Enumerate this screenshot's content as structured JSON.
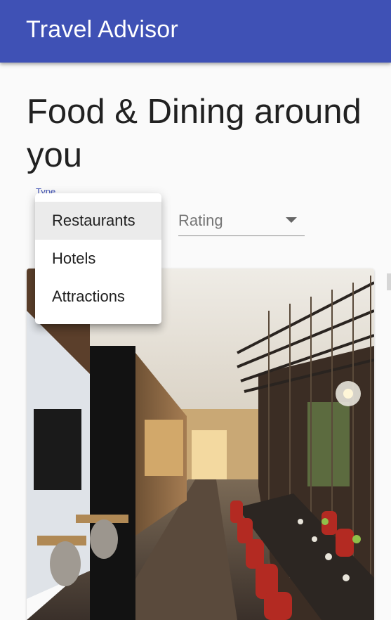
{
  "app": {
    "title": "Travel Advisor"
  },
  "page": {
    "title": "Food & Dining around you"
  },
  "type_select": {
    "label": "Type",
    "selected": "Restaurants",
    "options": [
      "Restaurants",
      "Hotels",
      "Attractions"
    ]
  },
  "rating_select": {
    "label": "Rating"
  },
  "colors": {
    "appbar": "#3f51b5",
    "accent": "#3f51b5",
    "background": "#fafafa"
  }
}
